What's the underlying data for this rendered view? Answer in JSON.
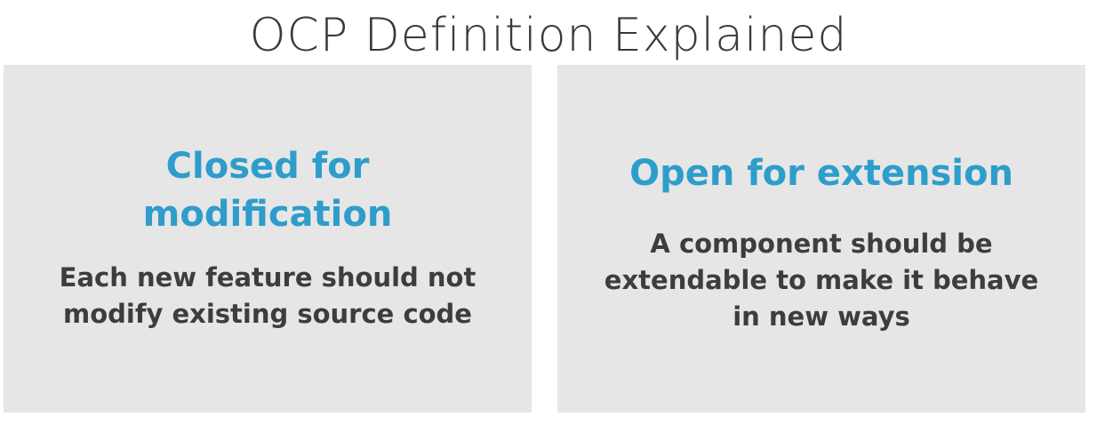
{
  "slide": {
    "title": "OCP Definition Explained"
  },
  "panels": {
    "left": {
      "heading_lines": [
        "Closed for",
        "modification"
      ],
      "body_lines": [
        "Each new feature should not",
        "modify existing source code"
      ]
    },
    "right": {
      "heading_lines": [
        "Open for extension"
      ],
      "body_lines": [
        "A component should be",
        "extendable to make it behave",
        "in new ways"
      ]
    }
  },
  "colors": {
    "heading": "#2e9dcb",
    "body_text": "#3d3d3d",
    "panel_background": "#e6e6e6",
    "title": "#3a3a3a"
  }
}
